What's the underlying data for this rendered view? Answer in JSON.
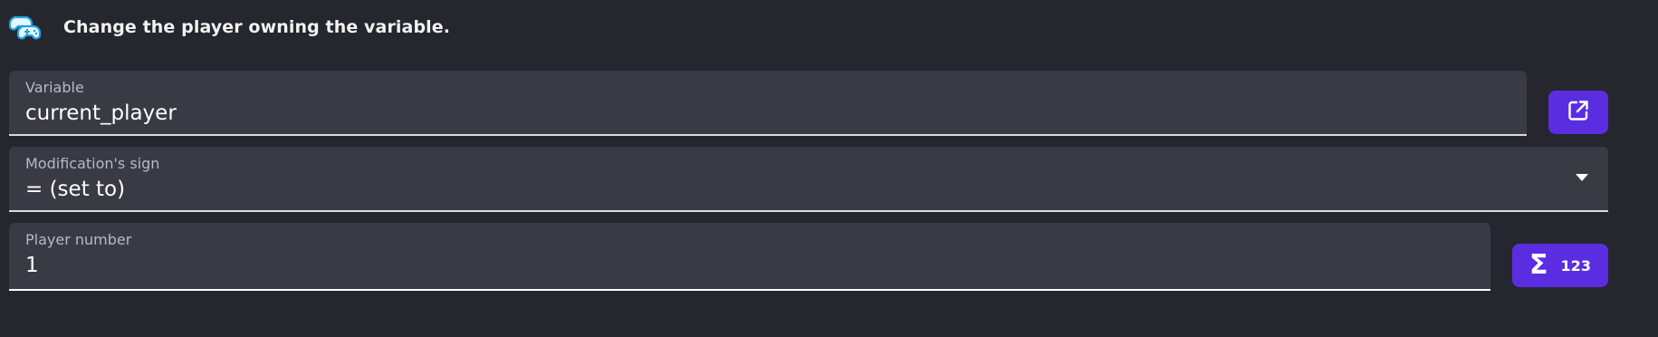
{
  "header": {
    "description": "Change the player owning the variable."
  },
  "fields": {
    "variable": {
      "label": "Variable",
      "value": "current_player"
    },
    "sign": {
      "label": "Modification's sign",
      "value": "= (set to)"
    },
    "player_number": {
      "label": "Player number",
      "value": "1"
    }
  },
  "buttons": {
    "expression_sigma": "Σ",
    "expression_number": "123"
  },
  "icons": {
    "app": "gamepads-icon",
    "open_variable": "external-link-icon",
    "dropdown": "chevron-down-icon"
  },
  "colors": {
    "background": "#25262e",
    "field": "#393a44",
    "accent": "#5a2ee0"
  }
}
